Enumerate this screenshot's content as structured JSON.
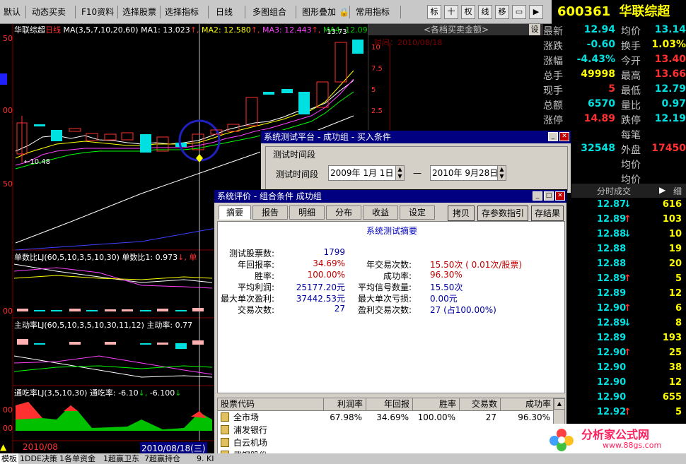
{
  "toolbar": {
    "items": [
      "默认",
      "动态买卖",
      "F10资料",
      "选择股票",
      "选择指标",
      "日线",
      "多图组合",
      "图形叠加",
      "常用指标"
    ],
    "right_buttons": [
      "标",
      "十",
      "权",
      "线",
      "移"
    ],
    "stock_code": "600361",
    "stock_name": "华联综超"
  },
  "chart": {
    "main_title": "华联综超",
    "period": "日线",
    "ma_label": "MA(3,5,7,10,20,60)",
    "ma1": "MA1: 13.023",
    "ma2": "MA2: 12.580",
    "ma3": "MA3: 12.443",
    "ma4": "MA4: 12.09",
    "high_mark": "13.73",
    "low_mark": "10.48",
    "ind1_title": "单数比LJ(60,5,10,3,5,10,30)",
    "ind1_value": "单数比1: 0.973",
    "ind2_title": "主动率LJ(60,5,10,3,5,10,30,11,12)",
    "ind2_value": "主动率: 0.77",
    "ind3_title": "通吃率LJ(3,5,10,30)",
    "ind3_value": "通吃率: -6.10",
    "ind3_value2": "-6.100",
    "axis_labels": [
      "50",
      "00",
      "50",
      "00",
      "00",
      "00"
    ],
    "date_left": "2010/08",
    "date_cursor": "2010/08/18(三)",
    "colors": {
      "up": "#ff3030",
      "down": "#00e0e0",
      "ma": "#ffff00"
    }
  },
  "midpanel": {
    "title": "<各档买卖金额>",
    "btn": "设",
    "time": "时间：2010/08/18",
    "ticks": [
      "10",
      "7.5",
      "5",
      "2.5"
    ]
  },
  "quote": {
    "rows": [
      {
        "l1": "最新",
        "v1": "12.94",
        "l2": "均价",
        "v2": "13.14"
      },
      {
        "l1": "涨跌",
        "v1": "-0.60",
        "l2": "换手",
        "v2": "1.03%"
      },
      {
        "l1": "涨幅",
        "v1": "-4.43%",
        "l2": "今开",
        "v2": "13.40"
      },
      {
        "l1": "总手",
        "v1": "49998",
        "l2": "最高",
        "v2": "13.66"
      },
      {
        "l1": "现手",
        "v1": "5",
        "l2": "最低",
        "v2": "12.79"
      },
      {
        "l1": "总额",
        "v1": "6570",
        "l2": "量比",
        "v2": "0.97"
      },
      {
        "l1": "涨停",
        "v1": "14.89",
        "l2": "跌停",
        "v2": "12.19"
      },
      {
        "l1": "",
        "v1": "",
        "l2": "每笔",
        "v2": ""
      },
      {
        "l1": "",
        "v1": "32548",
        "l2": "外盘",
        "v2": "17450"
      },
      {
        "l1": "",
        "v1": "",
        "l2": "均价",
        "v2": ""
      },
      {
        "l1": "",
        "v1": "",
        "l2": "均价",
        "v2": ""
      }
    ],
    "tab_trades": "分时成交",
    "tab_detail": "细"
  },
  "trades": [
    {
      "price": "12.87",
      "dir": "down",
      "vol": "616"
    },
    {
      "price": "12.89",
      "dir": "up",
      "vol": "103"
    },
    {
      "price": "12.88",
      "dir": "down",
      "vol": "10"
    },
    {
      "price": "12.88",
      "dir": "",
      "vol": "19"
    },
    {
      "price": "12.88",
      "dir": "",
      "vol": "20"
    },
    {
      "price": "12.89",
      "dir": "up",
      "vol": "5"
    },
    {
      "price": "12.89",
      "dir": "",
      "vol": "12"
    },
    {
      "price": "12.90",
      "dir": "up",
      "vol": "6"
    },
    {
      "price": "12.89",
      "dir": "down",
      "vol": "8"
    },
    {
      "price": "12.89",
      "dir": "",
      "vol": "193"
    },
    {
      "price": "12.90",
      "dir": "up",
      "vol": "25"
    },
    {
      "price": "12.90",
      "dir": "",
      "vol": "38"
    },
    {
      "price": "12.90",
      "dir": "",
      "vol": "12"
    },
    {
      "price": "12.90",
      "dir": "",
      "vol": "655"
    },
    {
      "price": "12.92",
      "dir": "up",
      "vol": "5"
    }
  ],
  "dialog_back": {
    "title": "系统测试平台 - 成功组 - 买入条件",
    "group_label": "测试时间段",
    "period_label": "测试时间段",
    "date_from": "2009年 1月 1日",
    "dash": "—",
    "date_to": "2010年 9月28日"
  },
  "dialog_front": {
    "title": "系统评价 - 组合条件 成功组",
    "tabs": [
      "摘要",
      "报告",
      "明细",
      "分布",
      "收益",
      "设定"
    ],
    "buttons": [
      "拷贝",
      "存参数指引",
      "存结果"
    ],
    "summary_title": "系统测试摘要",
    "stats_left": [
      {
        "label": "测试股票数:",
        "value": "1799"
      },
      {
        "label": "年回报率:",
        "value": "34.69%"
      },
      {
        "label": "胜率:",
        "value": "100.00%"
      },
      {
        "label": "平均利润:",
        "value": "25177.20元"
      },
      {
        "label": "最大单次盈利:",
        "value": "37442.53元"
      },
      {
        "label": "交易次数:",
        "value": "27"
      }
    ],
    "stats_right": [
      {
        "label": "",
        "value": ""
      },
      {
        "label": "年交易次数:",
        "value": "15.50次 ( 0.01次/股票)"
      },
      {
        "label": "成功率:",
        "value": "96.30%"
      },
      {
        "label": "平均信号数量:",
        "value": "15.50次"
      },
      {
        "label": "最大单次亏损:",
        "value": "0.00元"
      },
      {
        "label": "盈利交易次数:",
        "value": "27 (占100.00%)"
      }
    ],
    "table_headers": [
      "股票代码",
      "利润率",
      "年回报",
      "胜率",
      "交易数",
      "成功率"
    ],
    "table_rows": [
      {
        "name": "全市场",
        "profit": "67.98%",
        "annual": "34.69%",
        "win": "100.00%",
        "trades": "27",
        "success": "96.30%"
      },
      {
        "name": "浦发银行",
        "profit": "",
        "annual": "",
        "win": "",
        "trades": "",
        "success": ""
      },
      {
        "name": "白云机场",
        "profit": "",
        "annual": "",
        "win": "",
        "trades": "",
        "success": ""
      },
      {
        "name": "武钢股份",
        "profit": "",
        "annual": "",
        "win": "",
        "trades": "",
        "success": ""
      }
    ]
  },
  "bottombar": {
    "items": [
      "模板",
      "1DDE决策",
      "1各单资金",
      "1超赢卫东",
      "7超赢持仓",
      "9. KI"
    ]
  },
  "watermark": {
    "brand": "分析家公式网",
    "url": "www.88gs.com"
  }
}
